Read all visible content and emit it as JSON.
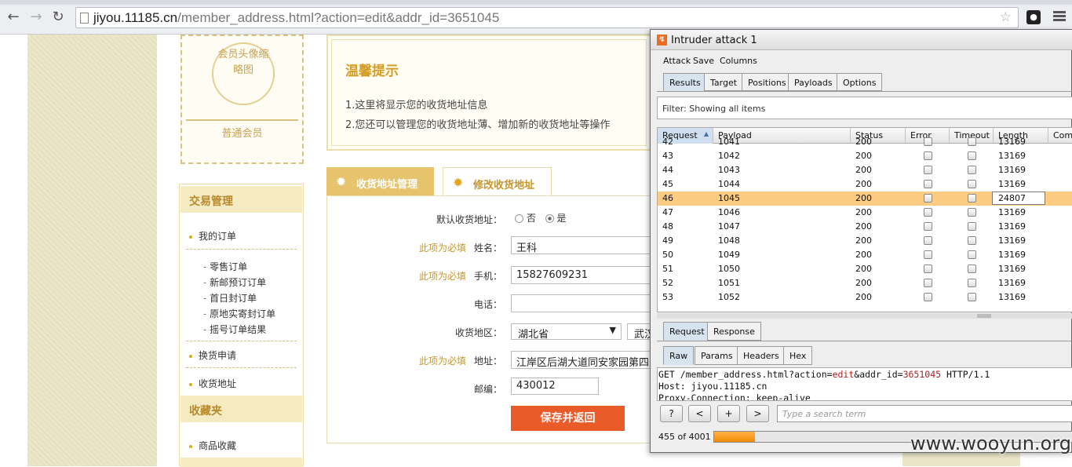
{
  "browser": {
    "url_host": "jiyou.11185.cn",
    "url_path": "/member_address.html?action=edit&addr_id=3651045"
  },
  "avatar": {
    "alt_text": "会员头像缩略图",
    "level": "普通会员"
  },
  "sidebar": {
    "section1": "交易管理",
    "my_orders": "我的订单",
    "sub_orders": [
      "零售订单",
      "新邮预订订单",
      "首日封订单",
      "原地实寄封订单",
      "摇号订单结果"
    ],
    "exchange": "换货申请",
    "address": "收货地址",
    "section2": "收藏夹",
    "favorites": "商品收藏"
  },
  "tips": {
    "title": "温馨提示",
    "line1": "1.这里将显示您的收货地址信息",
    "line2": "2.您还可以管理您的收货地址薄、增加新的收货地址等操作"
  },
  "tabs": {
    "manage": "收货地址管理",
    "edit": "修改收货地址"
  },
  "form": {
    "default_label": "默认收货地址：",
    "no": "否",
    "yes": "是",
    "default_value": "是",
    "required": "此项为必填",
    "name_label": "姓名：",
    "name_value": "王科",
    "mobile_label": "手机：",
    "mobile_value": "15827609231",
    "phone_label": "电话：",
    "phone_value": "",
    "region_label": "收货地区：",
    "province": "湖北省",
    "city": "武汉",
    "address_label": "地址：",
    "address_value": "江岸区后湖大道同安家园第四",
    "zip_label": "邮编：",
    "zip_value": "430012",
    "save": "保存并返回"
  },
  "burp": {
    "title": "Intruder attack 1",
    "menu": [
      "Attack",
      "Save",
      "Columns"
    ],
    "tabs": [
      "Results",
      "Target",
      "Positions",
      "Payloads",
      "Options"
    ],
    "active_tab": "Results",
    "filter": "Filter:  Showing all items",
    "columns": [
      "Request",
      "Payload",
      "Status",
      "Error",
      "Timeout",
      "Length",
      "Comm"
    ],
    "rows": [
      {
        "req": "42",
        "payload": "1041",
        "status": "200",
        "length": "13169"
      },
      {
        "req": "43",
        "payload": "1042",
        "status": "200",
        "length": "13169"
      },
      {
        "req": "44",
        "payload": "1043",
        "status": "200",
        "length": "13169"
      },
      {
        "req": "45",
        "payload": "1044",
        "status": "200",
        "length": "13169"
      },
      {
        "req": "46",
        "payload": "1045",
        "status": "200",
        "length": "24807"
      },
      {
        "req": "47",
        "payload": "1046",
        "status": "200",
        "length": "13169"
      },
      {
        "req": "48",
        "payload": "1047",
        "status": "200",
        "length": "13169"
      },
      {
        "req": "49",
        "payload": "1048",
        "status": "200",
        "length": "13169"
      },
      {
        "req": "50",
        "payload": "1049",
        "status": "200",
        "length": "13169"
      },
      {
        "req": "51",
        "payload": "1050",
        "status": "200",
        "length": "13169"
      },
      {
        "req": "52",
        "payload": "1051",
        "status": "200",
        "length": "13169"
      },
      {
        "req": "53",
        "payload": "1052",
        "status": "200",
        "length": "13169"
      }
    ],
    "selected_row": "46",
    "reqresp_tabs": [
      "Request",
      "Response"
    ],
    "view_tabs": [
      "Raw",
      "Params",
      "Headers",
      "Hex"
    ],
    "raw": {
      "l1_a": "GET /member_address.html?action=",
      "l1_b": "edit",
      "l1_c": "&addr_id=",
      "l1_d": "3651045",
      "l1_e": " HTTP/1.1",
      "l2": "Host: jiyou.11185.cn",
      "l3": "Proxy-Connection: keep-alive"
    },
    "search_buttons": [
      "?",
      "<",
      "+",
      ">"
    ],
    "search_placeholder": "Type a search term",
    "progress_text": "455 of 4001",
    "progress_fraction": 0.1137,
    "colors": {
      "selected_row": "#fccc83",
      "progress": "#f08a05"
    }
  },
  "watermark": "www.wooyun.org"
}
